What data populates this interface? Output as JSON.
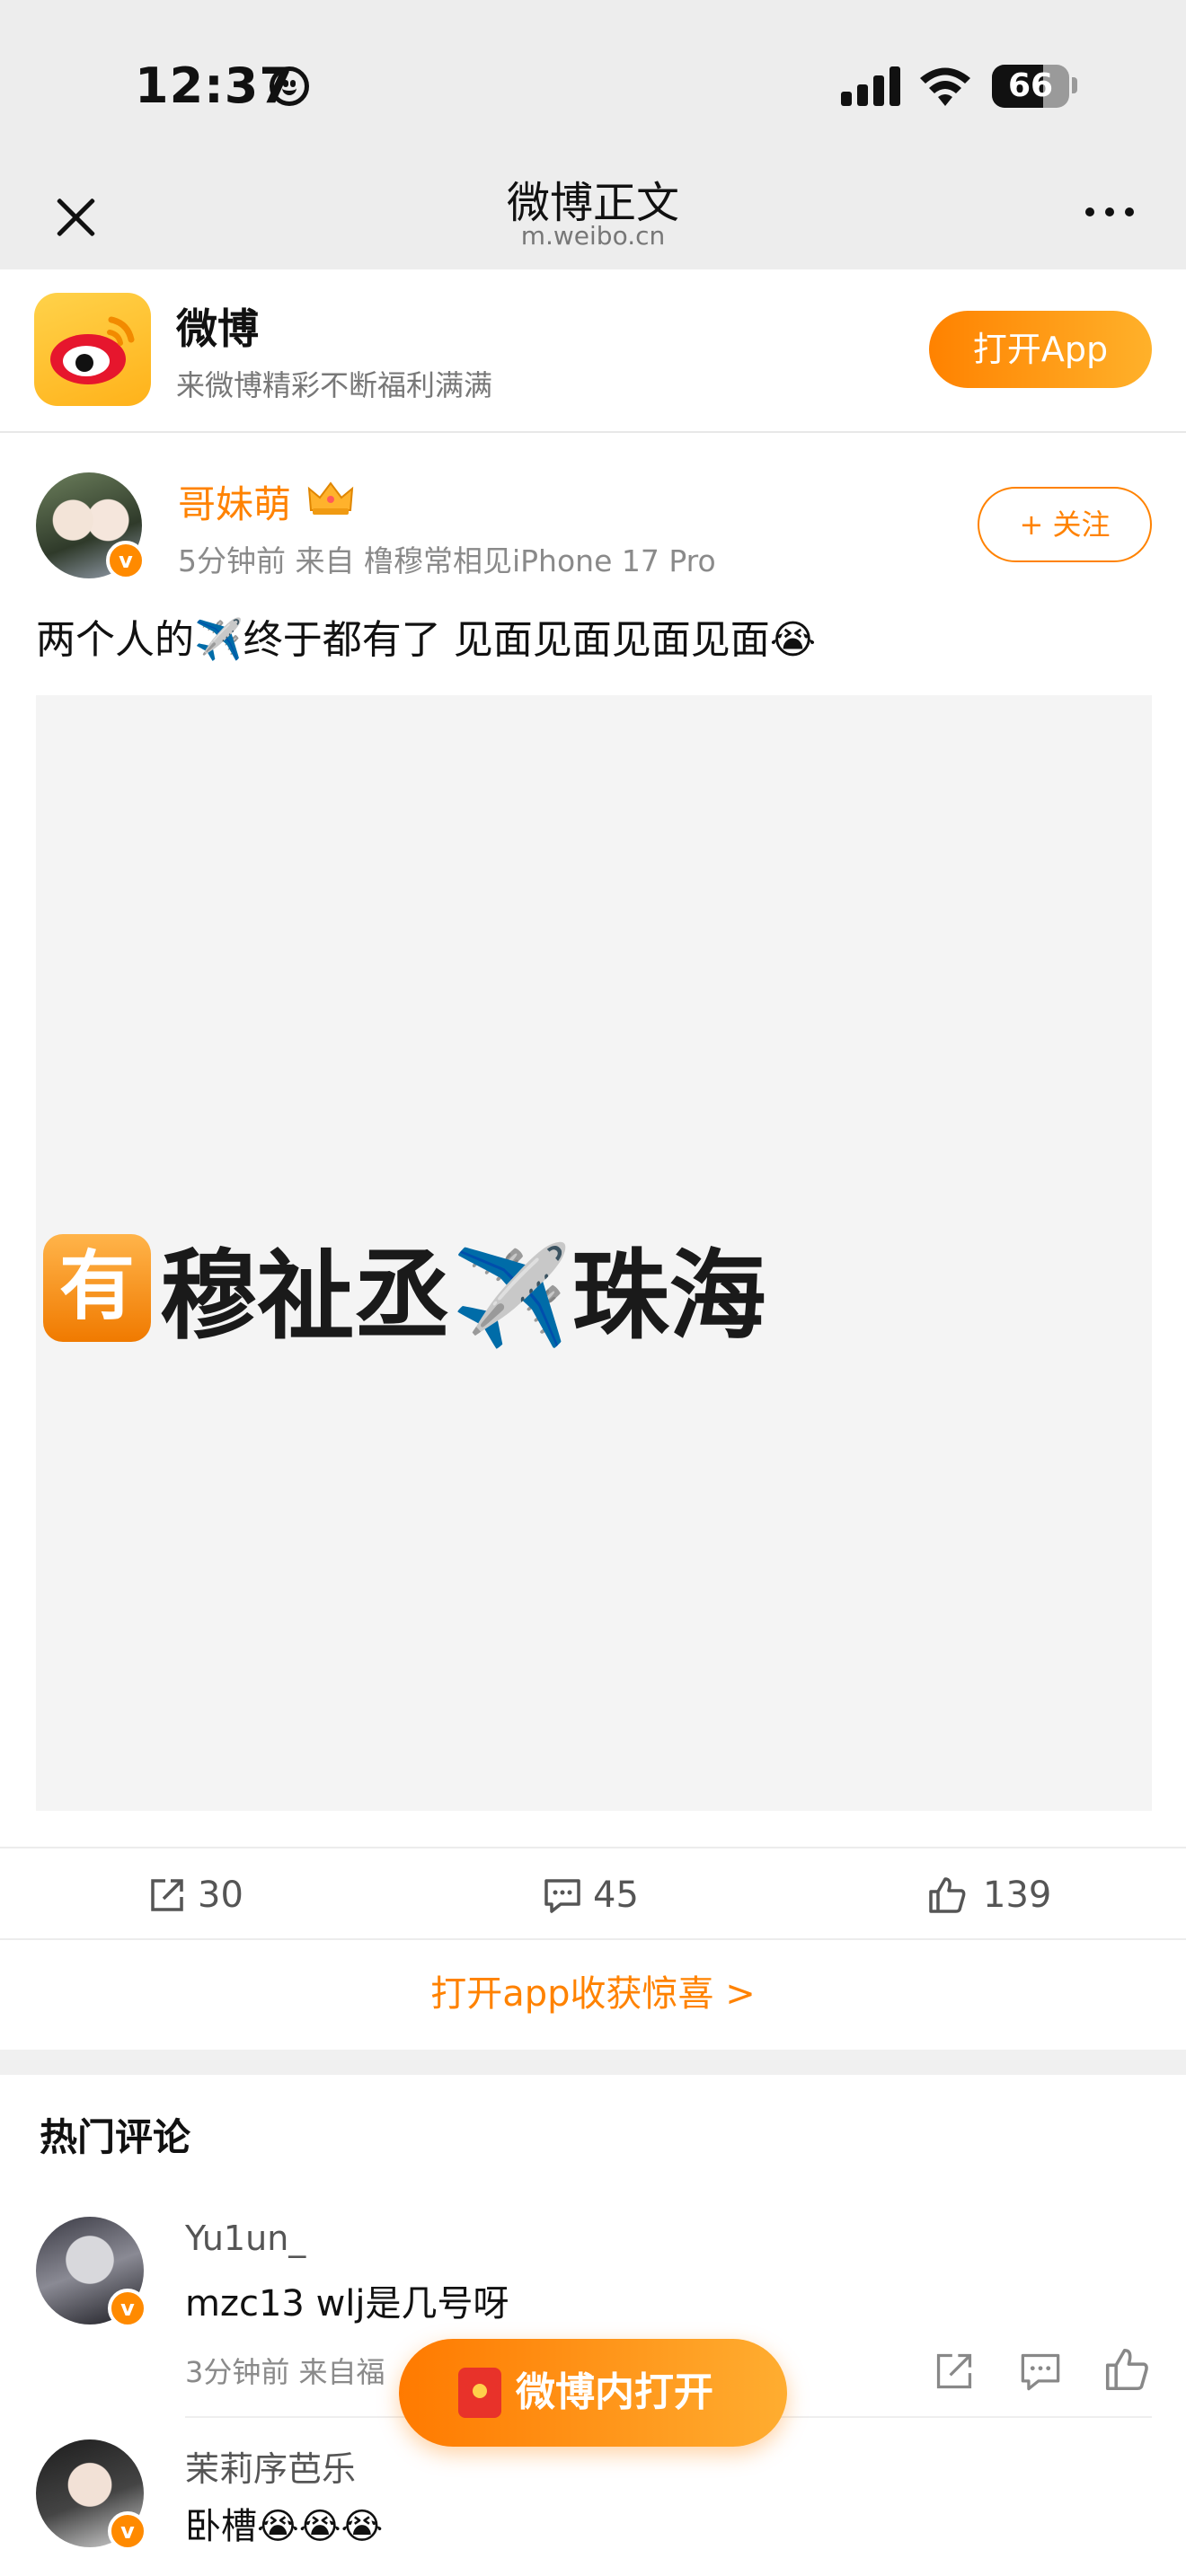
{
  "status_bar": {
    "time": "12:37",
    "battery": "66",
    "battery_level": 0.66
  },
  "nav": {
    "title": "微博正文",
    "url": "m.weibo.cn"
  },
  "banner": {
    "app_name": "微博",
    "subtitle": "来微博精彩不断福利满满",
    "open_label": "打开App"
  },
  "post": {
    "author": "哥妹萌",
    "meta": "5分钟前  来自 橹穆常相见iPhone 17 Pro",
    "follow_label": "关注",
    "text": "两个人的✈️终于都有了 见面见面见面见面😭",
    "image_text": "穆祉丞✈️珠海",
    "image_badge": "有",
    "reposts": "30",
    "comments": "45",
    "likes": "139"
  },
  "gift_link": "打开app收获惊喜 >",
  "hot_comments": {
    "title": "热门评论",
    "items": [
      {
        "name": "Yu1un_",
        "text": "mzc13 wlj是几号呀",
        "meta": "3分钟前  来自福"
      },
      {
        "name": "茉莉序芭乐",
        "text": "卧槽😭😭😭"
      }
    ]
  },
  "floating_button": {
    "label": "微博内打开"
  },
  "colors": {
    "accent": "#ff8200",
    "nav_bg": "#ededed",
    "image_bg": "#f4f4f4"
  }
}
